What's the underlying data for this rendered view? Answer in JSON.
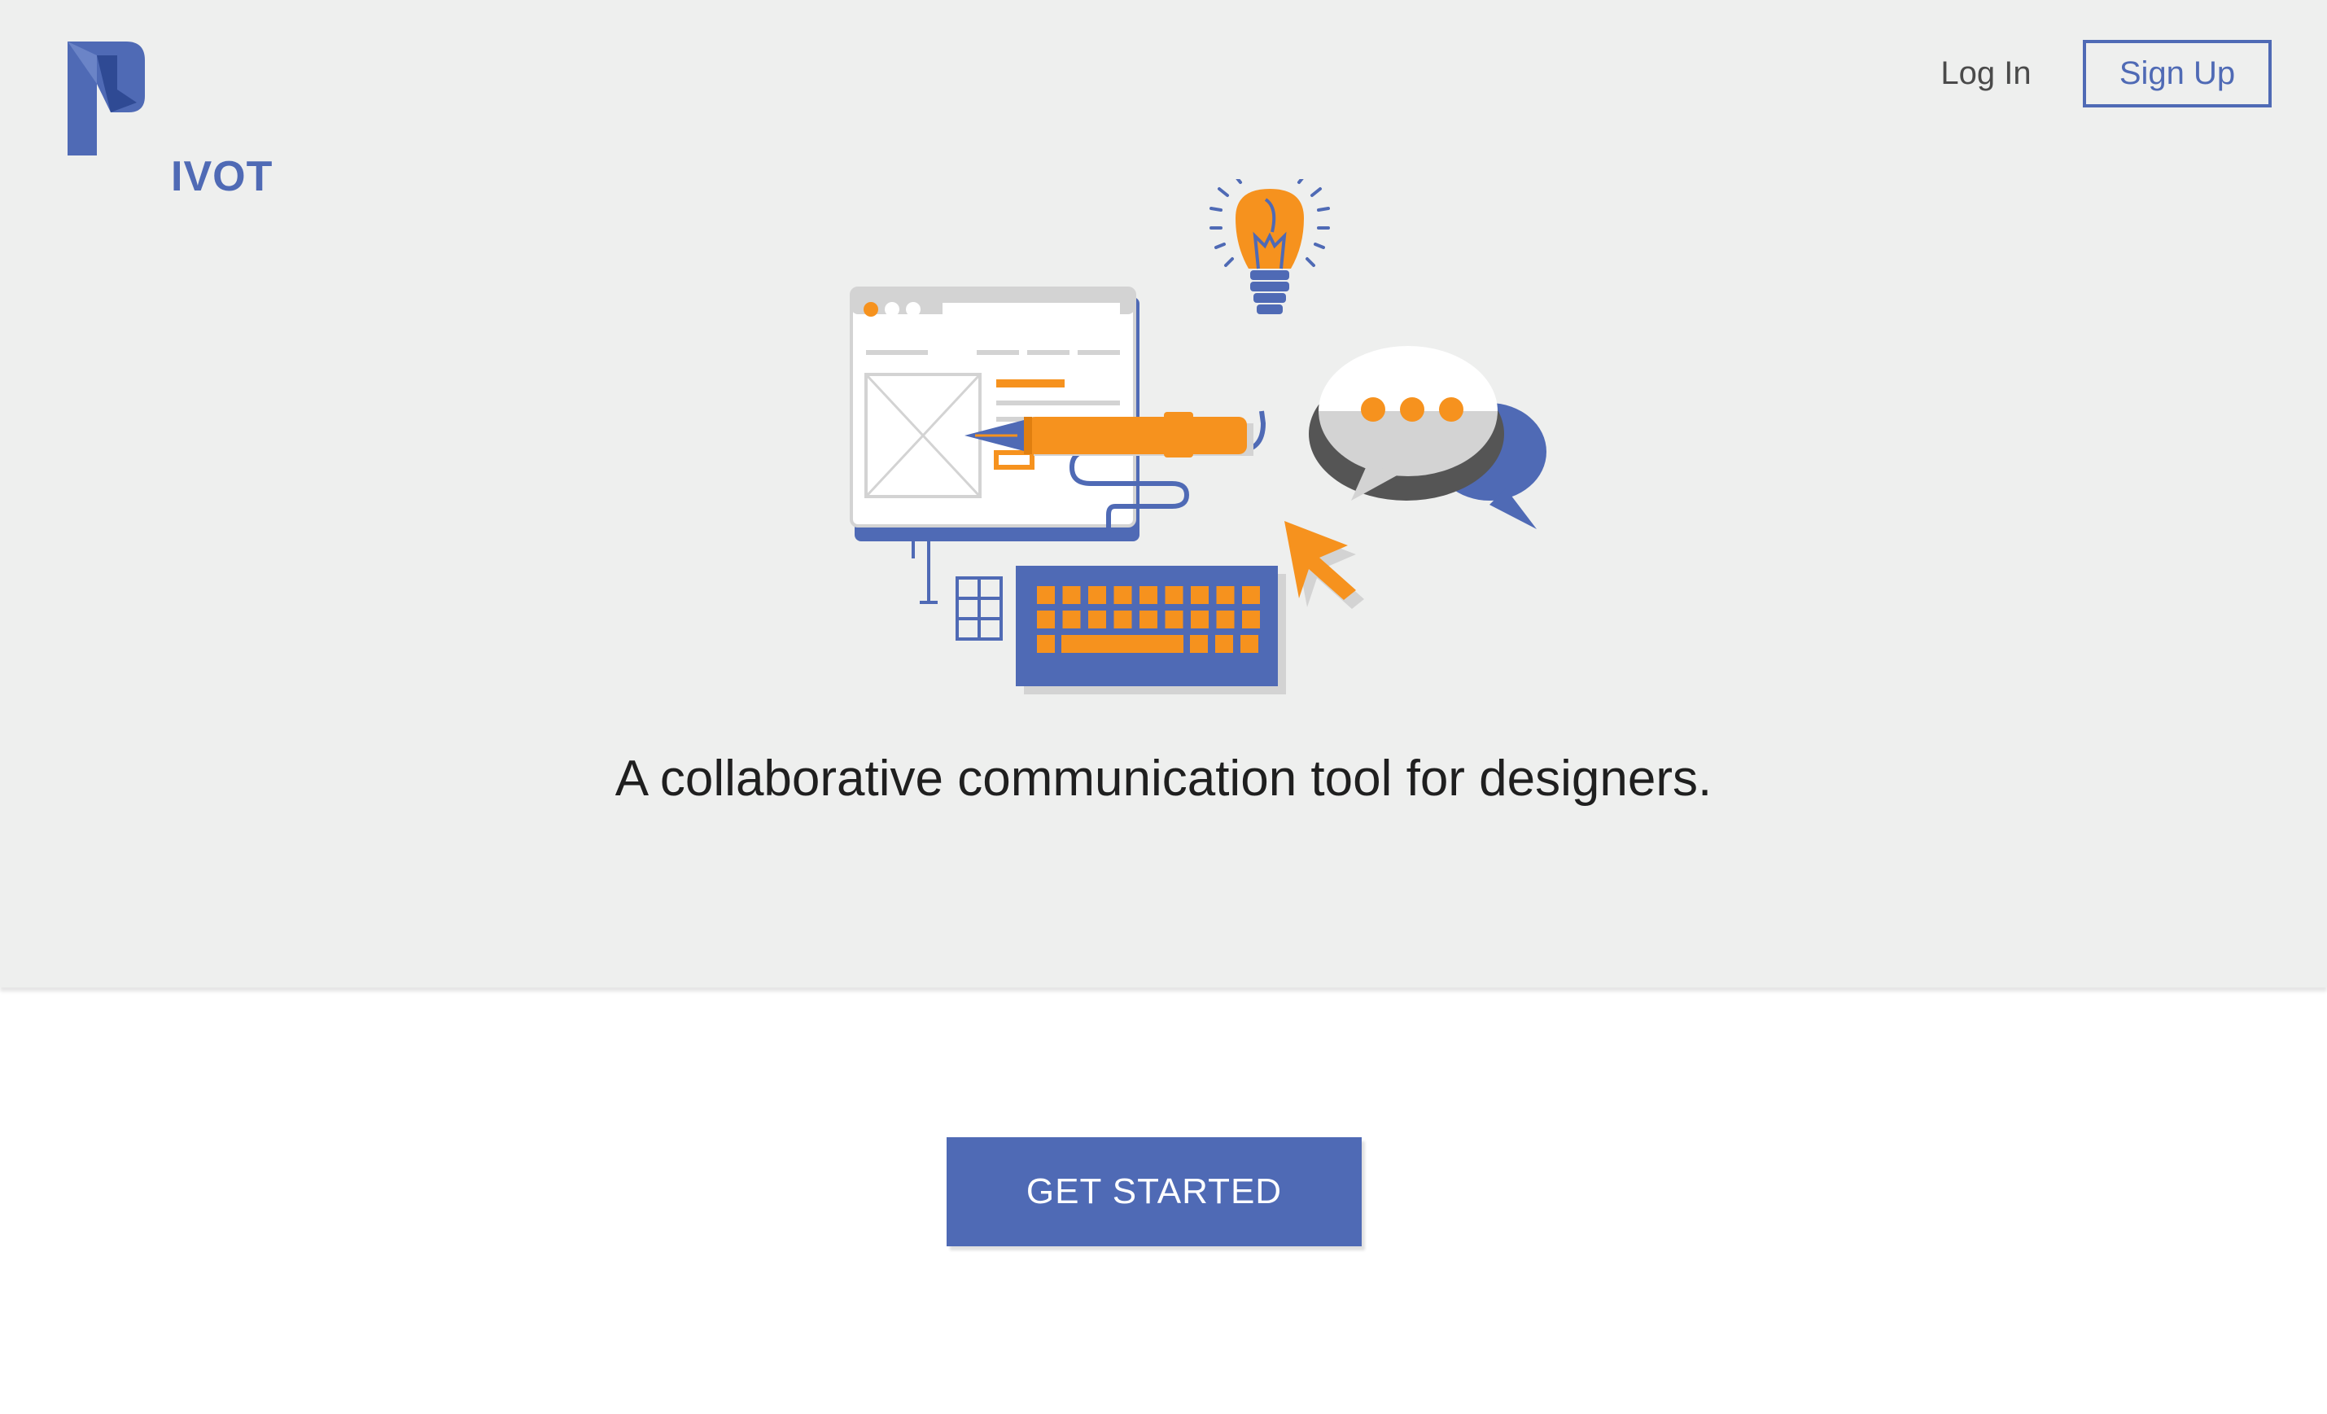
{
  "brand": {
    "wordmark": "IVOT",
    "primary_color": "#4f6ab5",
    "accent_color": "#f6921e"
  },
  "nav": {
    "login_label": "Log In",
    "signup_label": "Sign Up"
  },
  "hero": {
    "tagline": "A collaborative communication tool for designers.",
    "illustration_icons": [
      "browser-window-icon",
      "pen-icon",
      "light-bulb-icon",
      "chat-bubbles-icon",
      "cursor-arrow-icon",
      "keyboard-icon",
      "text-table-icon"
    ]
  },
  "cta": {
    "label": "GET STARTED"
  }
}
